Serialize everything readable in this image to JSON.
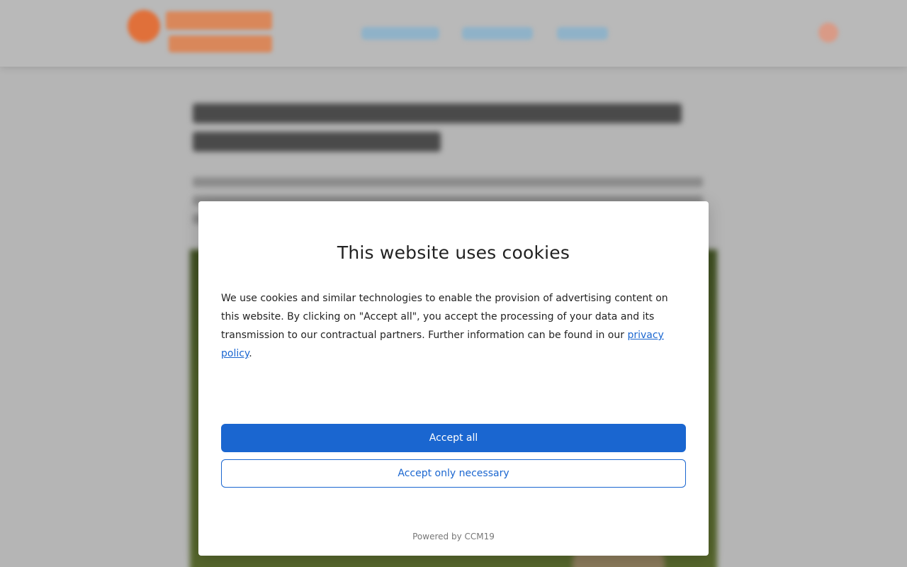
{
  "cookie_dialog": {
    "title": "This website uses cookies",
    "text_before_link": "We use cookies and similar technologies to enable the provision of advertising content on this website. By clicking on \"Accept all\", you accept the processing of your data and its transmission to our contractual partners. Further information can be found in our ",
    "link_text": "privacy policy",
    "text_after_link": ".",
    "accept_all_label": "Accept all",
    "accept_necessary_label": "Accept only necessary",
    "powered_by": "Powered by CCM19"
  },
  "colors": {
    "accent": "#1a66d0",
    "overlay": "#b5b5b5"
  },
  "icons": {
    "background_search": "search-icon"
  }
}
